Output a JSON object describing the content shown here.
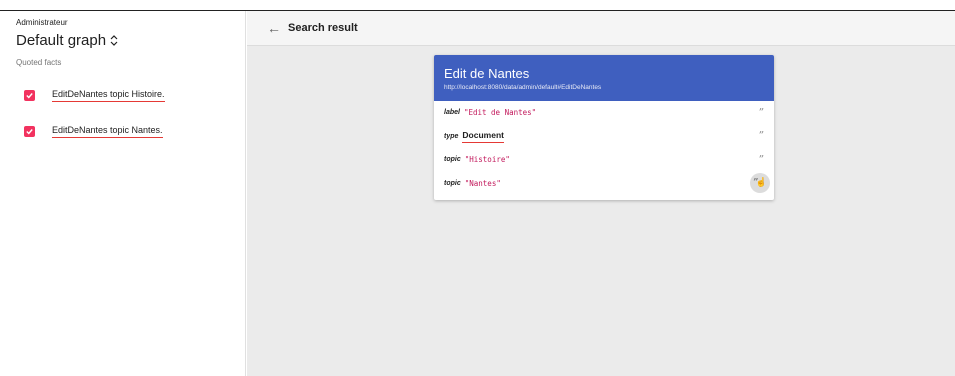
{
  "sidebar": {
    "role": "Administrateur",
    "graph_name": "Default graph",
    "section_label": "Quoted facts",
    "facts": [
      {
        "text": "EditDeNantes topic Histoire.",
        "checked": true
      },
      {
        "text": "EditDeNantes topic Nantes.",
        "checked": true
      }
    ]
  },
  "header": {
    "title": "Search result"
  },
  "card": {
    "title": "Edit de Nantes",
    "uri": "http://localhost:8080/data/admin/default#EditDeNantes",
    "properties": [
      {
        "name": "label",
        "value": "\"Edit de Nantes\"",
        "kind": "literal"
      },
      {
        "name": "type",
        "value": "Document",
        "kind": "resource"
      },
      {
        "name": "topic",
        "value": "\"Histoire\"",
        "kind": "literal"
      },
      {
        "name": "topic",
        "value": "\"Nantes\"",
        "kind": "literal"
      }
    ]
  },
  "colors": {
    "accent": "#f2325f",
    "card_header": "#3f5fbf",
    "literal": "#c2185b"
  },
  "icons": {
    "back": "arrow-left-icon",
    "quote": "format-quote-icon",
    "check": "check-icon",
    "hover_cursor": "hand-pointer-icon",
    "graph_chevron": "unfold-more-icon"
  }
}
